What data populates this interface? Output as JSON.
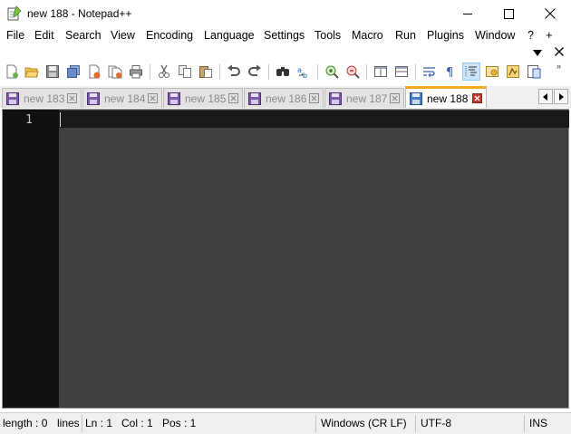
{
  "window": {
    "title": "new 188 - Notepad++",
    "app_icon": "notepad-icon",
    "controls": [
      "minimize-icon",
      "maximize-icon",
      "close-icon"
    ]
  },
  "menu": {
    "items": [
      "File",
      "Edit",
      "Search",
      "View",
      "Encoding",
      "Language",
      "Settings",
      "Tools",
      "Macro",
      "Run",
      "Plugins",
      "Window",
      "?"
    ],
    "add_symbol": "+",
    "dropdown_symbol": "▼",
    "close_symbol": "✕"
  },
  "toolbar": {
    "buttons": [
      "new-file-icon",
      "open-file-icon",
      "save-icon",
      "save-all-icon",
      "close-icon",
      "close-all-icon",
      "print-icon",
      "cut-icon",
      "copy-icon",
      "paste-icon",
      "undo-icon",
      "redo-icon",
      "find-icon",
      "replace-icon",
      "zoom-in-icon",
      "zoom-out-icon",
      "sync-vertical-icon",
      "sync-horizontal-icon",
      "word-wrap-icon",
      "show-all-characters-icon",
      "indent-guide-icon",
      "user-defined-language-icon",
      "document-map-icon",
      "function-list-icon"
    ],
    "overflow_symbol": "»"
  },
  "tabs": [
    {
      "label": "new 183",
      "active": false
    },
    {
      "label": "new 184",
      "active": false
    },
    {
      "label": "new 185",
      "active": false
    },
    {
      "label": "new 186",
      "active": false
    },
    {
      "label": "new 187",
      "active": false
    },
    {
      "label": "new 188",
      "active": true
    }
  ],
  "tab_nav": {
    "prev": "◂",
    "next": "▸"
  },
  "editor": {
    "line_numbers": [
      "1"
    ],
    "content": "",
    "background": "#404040",
    "gutter_background": "#111111"
  },
  "status": {
    "length": "length : 0",
    "lines": "lines",
    "ln": "Ln : 1",
    "col": "Col : 1",
    "pos": "Pos : 1",
    "eol": "Windows (CR LF)",
    "encoding": "UTF-8",
    "mode": "INS"
  },
  "colors": {
    "active_tab_accent": "#f5a623",
    "inactive_tab_text": "#8a8a8a",
    "floppy_icon": "#7b5aa6"
  }
}
